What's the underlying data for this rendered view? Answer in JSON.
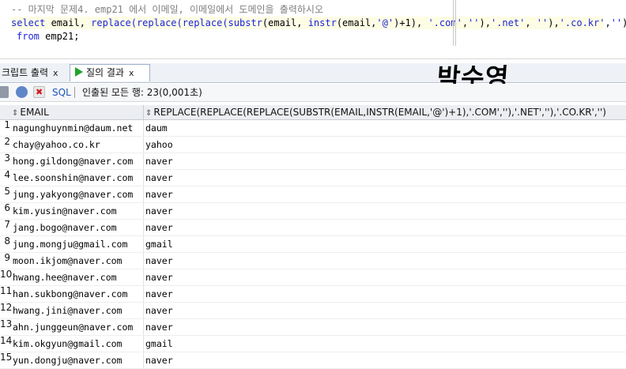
{
  "editor": {
    "line1": "-- 마지막 문제4. emp21 에서 이메일, 이메일에서 도메인을 출력하시오",
    "line2_kw1": "select",
    "line2_rest1": " email, ",
    "line2_kw2": "replace(replace(replace(substr",
    "line2_rest2": "(email, ",
    "line2_kw3": "instr",
    "line2_rest3": "(email,",
    "line2_str1": "'@'",
    "line2_rest4": ")+1), ",
    "line2_str2": "'.com'",
    "line2_rest5": ",",
    "line2_str3": "''",
    "line2_rest6": "),",
    "line2_str4": "'.net'",
    "line2_rest7": ", ",
    "line2_str5": "''",
    "line2_rest8": "),",
    "line2_str6": "'.co.kr'",
    "line2_rest9": ",",
    "line2_str7": "''",
    "line2_rest10": ")",
    "line3_kw": "from",
    "line3_rest": " emp21;"
  },
  "tabs": {
    "script_output": "크립트 출력",
    "query_result": "질의 결과",
    "close": "x"
  },
  "signature": "박수영",
  "toolbar": {
    "sql_label": "SQL",
    "status": "인출된 모든 행: 23(0,001초)"
  },
  "grid": {
    "col_email": "EMAIL",
    "col_replace": "REPLACE(REPLACE(REPLACE(SUBSTR(EMAIL,INSTR(EMAIL,'@')+1),'.COM',''),'.NET',''),'.CO.KR','')",
    "rows": [
      {
        "n": "1",
        "email": "nagunghuynmin@daum.net",
        "domain": "daum"
      },
      {
        "n": "2",
        "email": "chay@yahoo.co.kr",
        "domain": "yahoo"
      },
      {
        "n": "3",
        "email": "hong.gildong@naver.com",
        "domain": "naver"
      },
      {
        "n": "4",
        "email": "lee.soonshin@naver.com",
        "domain": "naver"
      },
      {
        "n": "5",
        "email": "jung.yakyong@naver.com",
        "domain": "naver"
      },
      {
        "n": "6",
        "email": "kim.yusin@naver.com",
        "domain": "naver"
      },
      {
        "n": "7",
        "email": "jang.bogo@naver.com",
        "domain": "naver"
      },
      {
        "n": "8",
        "email": "jung.mongju@gmail.com",
        "domain": "gmail"
      },
      {
        "n": "9",
        "email": "moon.ikjom@naver.com",
        "domain": "naver"
      },
      {
        "n": "10",
        "email": "hwang.hee@naver.com",
        "domain": "naver"
      },
      {
        "n": "11",
        "email": "han.sukbong@naver.com",
        "domain": "naver"
      },
      {
        "n": "12",
        "email": "hwang.jini@naver.com",
        "domain": "naver"
      },
      {
        "n": "13",
        "email": "ahn.junggeun@naver.com",
        "domain": "naver"
      },
      {
        "n": "14",
        "email": "kim.okgyun@gmail.com",
        "domain": "gmail"
      },
      {
        "n": "15",
        "email": "yun.dongju@naver.com",
        "domain": "naver"
      }
    ]
  }
}
